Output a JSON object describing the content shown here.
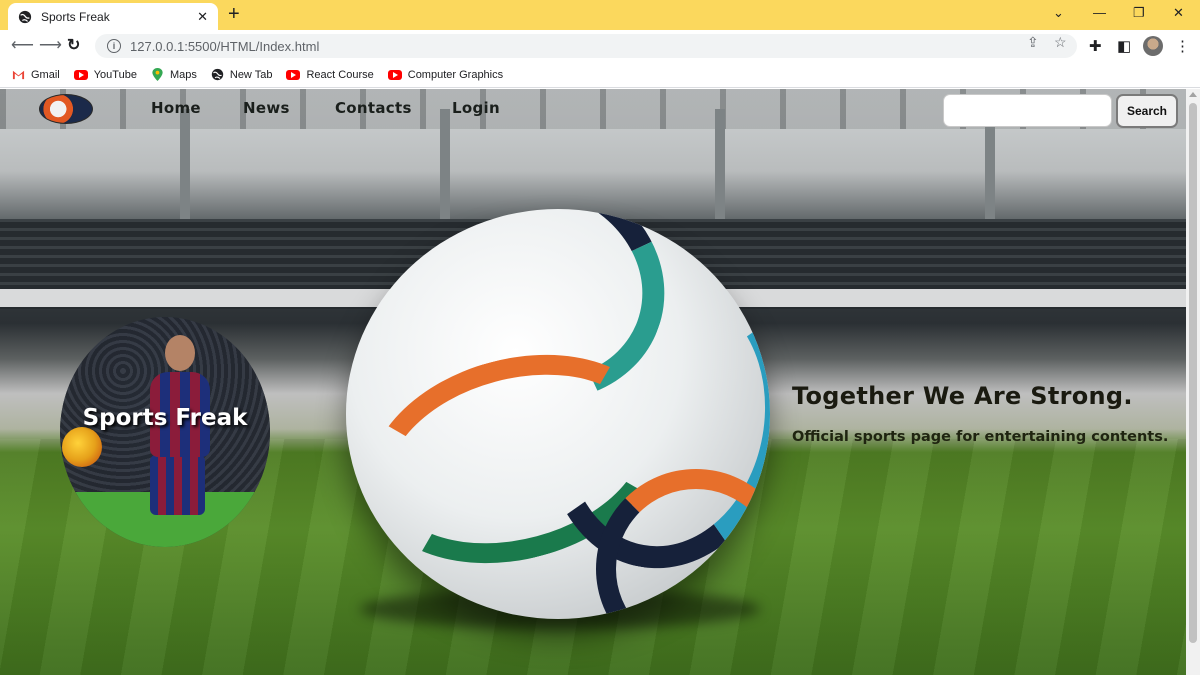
{
  "browser": {
    "tab_title": "Sports Freak",
    "tab_close": "✕",
    "new_tab": "+",
    "url": "127.0.0.1:5500/HTML/Index.html",
    "window_controls": [
      "⌄",
      "—",
      "❐",
      "✕"
    ],
    "bookmarks": [
      {
        "label": "Gmail",
        "icon": "gmail-icon"
      },
      {
        "label": "YouTube",
        "icon": "youtube-icon"
      },
      {
        "label": "Maps",
        "icon": "maps-icon"
      },
      {
        "label": "New Tab",
        "icon": "globe-icon"
      },
      {
        "label": "React Course",
        "icon": "youtube-icon"
      },
      {
        "label": "Computer Graphics",
        "icon": "youtube-icon"
      }
    ]
  },
  "site": {
    "nav": {
      "home": "Home",
      "news": "News",
      "contacts": "Contacts",
      "login": "Login"
    },
    "search": {
      "placeholder": "",
      "button_label": "Search"
    },
    "hero": {
      "circle_title": "Sports Freak",
      "tagline": "Together We Are Strong.",
      "subtagline": "Official sports page for entertaining contents."
    }
  },
  "colors": {
    "tabstrip": "#fbd85d",
    "youtube_red": "#ff0000",
    "tagline_text": "#1a1a10"
  }
}
